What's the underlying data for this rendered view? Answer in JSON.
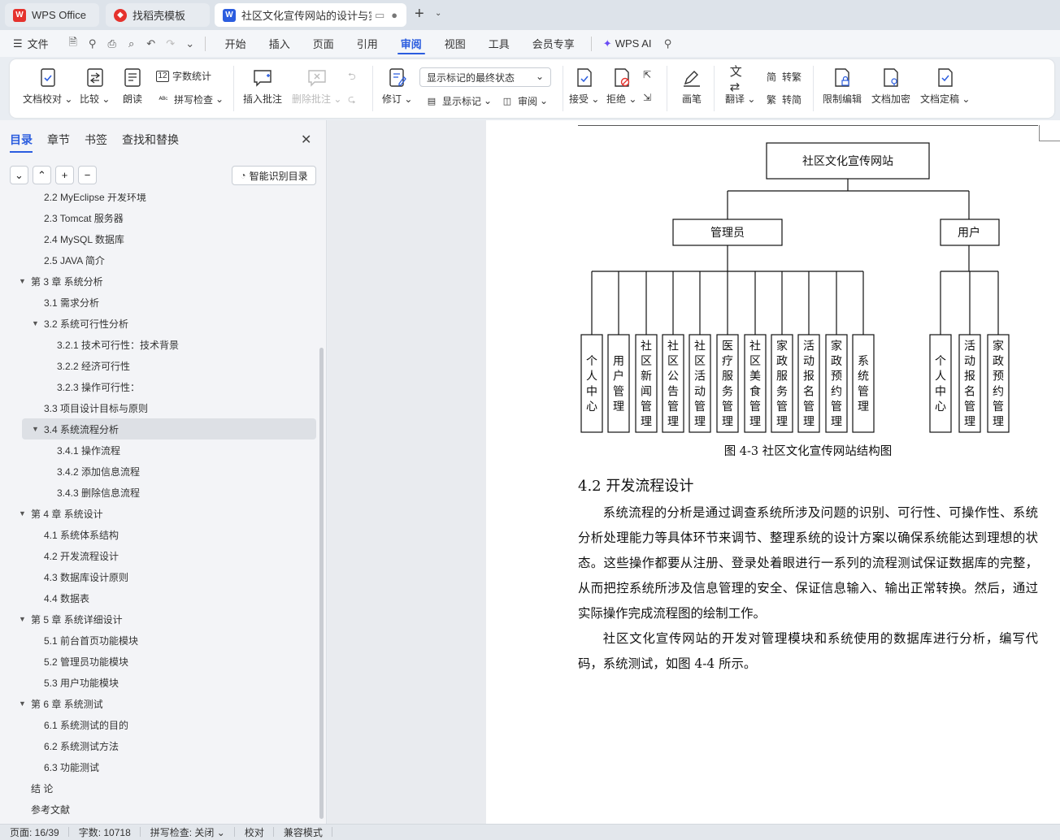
{
  "tabs": [
    {
      "label": "WPS Office"
    },
    {
      "label": "找稻壳模板"
    },
    {
      "label": "社区文化宣传网站的设计与实"
    }
  ],
  "menu": {
    "file": "文件",
    "items": [
      "开始",
      "插入",
      "页面",
      "引用",
      "审阅",
      "视图",
      "工具",
      "会员专享"
    ],
    "ai": "WPS AI"
  },
  "ribbon": {
    "doc_proof": "文档校对",
    "compare": "比较",
    "read": "朗读",
    "word_count": "字数统计",
    "spell_check": "拼写检查",
    "insert_comment": "插入批注",
    "delete_comment": "删除批注",
    "revise": "修订",
    "markup_state": "显示标记的最终状态",
    "show_markup": "显示标记",
    "review": "审阅",
    "accept": "接受",
    "reject": "拒绝",
    "pen": "画笔",
    "translate": "翻译",
    "to_trad": "转繁",
    "to_simp": "转简",
    "restrict_edit": "限制编辑",
    "encrypt": "文档加密",
    "finalize": "文档定稿"
  },
  "sidebar": {
    "tabs": [
      "目录",
      "章节",
      "书签",
      "查找和替换"
    ],
    "smart_toc": "智能识别目录",
    "toc": [
      {
        "text": "2.2 MyEclipse 开发环境",
        "lvl": 2
      },
      {
        "text": "2.3 Tomcat 服务器",
        "lvl": 2
      },
      {
        "text": "2.4 MySQL 数据库",
        "lvl": 2
      },
      {
        "text": "2.5 JAVA 简介",
        "lvl": 2
      },
      {
        "text": "第 3 章  系统分析",
        "lvl": 1,
        "open": true
      },
      {
        "text": "3.1  需求分析",
        "lvl": 2
      },
      {
        "text": "3.2  系统可行性分析",
        "lvl": 2,
        "open": true
      },
      {
        "text": "3.2.1 技术可行性：技术背景",
        "lvl": 3
      },
      {
        "text": "3.2.2 经济可行性",
        "lvl": 3
      },
      {
        "text": "3.2.3 操作可行性：",
        "lvl": 3
      },
      {
        "text": "3.3  项目设计目标与原则",
        "lvl": 2
      },
      {
        "text": "3.4 系统流程分析",
        "lvl": 2,
        "open": true,
        "selected": true
      },
      {
        "text": "3.4.1 操作流程",
        "lvl": 3
      },
      {
        "text": "3.4.2 添加信息流程",
        "lvl": 3
      },
      {
        "text": "3.4.3 删除信息流程",
        "lvl": 3
      },
      {
        "text": "第 4 章  系统设计",
        "lvl": 1,
        "open": true
      },
      {
        "text": "4.1  系统体系结构",
        "lvl": 2
      },
      {
        "text": "4.2 开发流程设计",
        "lvl": 2
      },
      {
        "text": "4.3  数据库设计原则",
        "lvl": 2
      },
      {
        "text": "4.4  数据表",
        "lvl": 2
      },
      {
        "text": "第 5 章  系统详细设计",
        "lvl": 1,
        "open": true
      },
      {
        "text": "5.1 前台首页功能模块",
        "lvl": 2
      },
      {
        "text": "5.2 管理员功能模块",
        "lvl": 2
      },
      {
        "text": "5.3 用户功能模块",
        "lvl": 2
      },
      {
        "text": "第 6 章   系统测试",
        "lvl": 1,
        "open": true
      },
      {
        "text": "6.1 系统测试的目的",
        "lvl": 2
      },
      {
        "text": "6.2 系统测试方法",
        "lvl": 2
      },
      {
        "text": "6.3 功能测试",
        "lvl": 2
      },
      {
        "text": "结    论",
        "lvl": 1
      },
      {
        "text": "参考文献",
        "lvl": 1
      }
    ]
  },
  "document": {
    "diagram": {
      "root": "社区文化宣传网站",
      "admin": "管理员",
      "user": "用户",
      "admin_items": [
        "个人中心",
        "用户管理",
        "社区新闻管理",
        "社区公告管理",
        "社区活动管理",
        "医疗服务管理",
        "社区美食管理",
        "家政服务管理",
        "活动报名管理",
        "家政预约管理",
        "系统管理"
      ],
      "user_items": [
        "个人中心",
        "活动报名管理",
        "家政预约管理"
      ]
    },
    "caption": "图 4-3  社区文化宣传网站结构图",
    "heading": "4.2 开发流程设计",
    "para1": "系统流程的分析是通过调查系统所涉及问题的识别、可行性、可操作性、系统分析处理能力等具体环节来调节、整理系统的设计方案以确保系统能达到理想的状态。这些操作都要从注册、登录处着眼进行一系列的流程测试保证数据库的完整，从而把控系统所涉及信息管理的安全、保证信息输入、输出正常转换。然后，通过实际操作完成流程图的绘制工作。",
    "para2": "社区文化宣传网站的开发对管理模块和系统使用的数据库进行分析，编写代码，系统测试，如图 4-4 所示。"
  },
  "status": {
    "page": "页面: 16/39",
    "words": "字数: 10718",
    "spell": "拼写检查: 关闭",
    "proof": "校对",
    "compat": "兼容模式"
  },
  "colors": {
    "accent": "#2b5ddf",
    "wps_red": "#e5322d"
  }
}
